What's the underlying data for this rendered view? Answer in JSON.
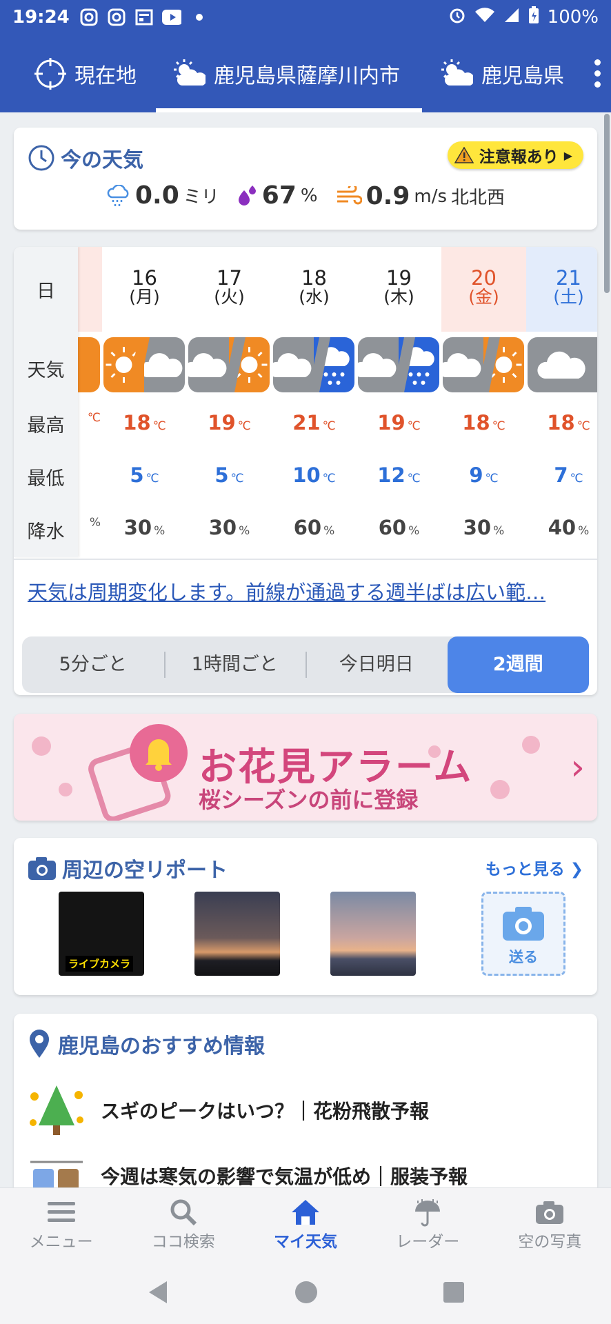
{
  "statusbar": {
    "time": "19:24",
    "battery": "100%",
    "icons": [
      "instagram-icon",
      "instagram-icon",
      "news-icon",
      "youtube-icon",
      "dot-icon",
      "alarm-icon",
      "wifi-icon",
      "signal-icon",
      "battery-icon"
    ]
  },
  "tabs": [
    {
      "label": "現在地",
      "icon": "location-target-icon"
    },
    {
      "label": "鹿児島県薩摩川内市",
      "icon": "sun-cloud-icon"
    },
    {
      "label": "鹿児島県",
      "icon": "sun-cloud-icon"
    }
  ],
  "now": {
    "title": "今の天気",
    "alert": "注意報あり",
    "rain_value": "0.0",
    "rain_unit": "ミリ",
    "humidity_value": "67",
    "humidity_unit": "%",
    "wind_value": "0.9",
    "wind_unit": "m/s",
    "wind_dir": "北北西"
  },
  "week": {
    "row_labels": {
      "day": "日",
      "weather": "天気",
      "high": "最高",
      "low": "最低",
      "precip": "降水"
    },
    "temp_unit": "℃",
    "precip_unit": "%",
    "days": [
      {
        "date": "16",
        "weekday": "(月)",
        "weather": "sun-then-cloud",
        "high": "18",
        "low": "5",
        "precip": "30"
      },
      {
        "date": "17",
        "weekday": "(火)",
        "weather": "cloud-then-sun",
        "high": "19",
        "low": "5",
        "precip": "30"
      },
      {
        "date": "18",
        "weekday": "(水)",
        "weather": "cloud-then-rain",
        "high": "21",
        "low": "10",
        "precip": "60"
      },
      {
        "date": "19",
        "weekday": "(木)",
        "weather": "cloud-then-rain",
        "high": "19",
        "low": "12",
        "precip": "60"
      },
      {
        "date": "20",
        "weekday": "(金)",
        "weather": "cloud-then-sun",
        "high": "18",
        "low": "9",
        "precip": "30"
      },
      {
        "date": "21",
        "weekday": "(土)",
        "weather": "cloud",
        "high": "18",
        "low": "7",
        "precip": "40"
      }
    ],
    "description": "天気は周期変化します。前線が通過する週半ばは広い範…",
    "segments": [
      "5分ごと",
      "1時間ごと",
      "今日明日",
      "2週間"
    ],
    "active_segment": "2週間"
  },
  "banner": {
    "title": "お花見アラーム",
    "subtitle": "桜シーズンの前に登録"
  },
  "sky": {
    "title": "周辺の空リポート",
    "more": "もっと見る",
    "live_label": "ライブカメラ",
    "send_label": "送る"
  },
  "rec": {
    "title": "鹿児島のおすすめ情報",
    "items": [
      "スギのピークはいつ？｜花粉飛散予報",
      "今週は寒気の影響で気温が低め｜服装予報"
    ]
  },
  "bottomnav": [
    {
      "label": "メニュー",
      "icon": "menu-icon"
    },
    {
      "label": "ココ検索",
      "icon": "search-icon"
    },
    {
      "label": "マイ天気",
      "icon": "home-icon"
    },
    {
      "label": "レーダー",
      "icon": "radar-umbrella-icon"
    },
    {
      "label": "空の写真",
      "icon": "camera-icon"
    }
  ],
  "colors": {
    "brand": "#3358b8",
    "high": "#e0532b",
    "low": "#2d6fd8",
    "saturday_bg": "#e3ecfb",
    "friday_bg": "#fde8e4",
    "active_tab": "#4d85e8"
  }
}
